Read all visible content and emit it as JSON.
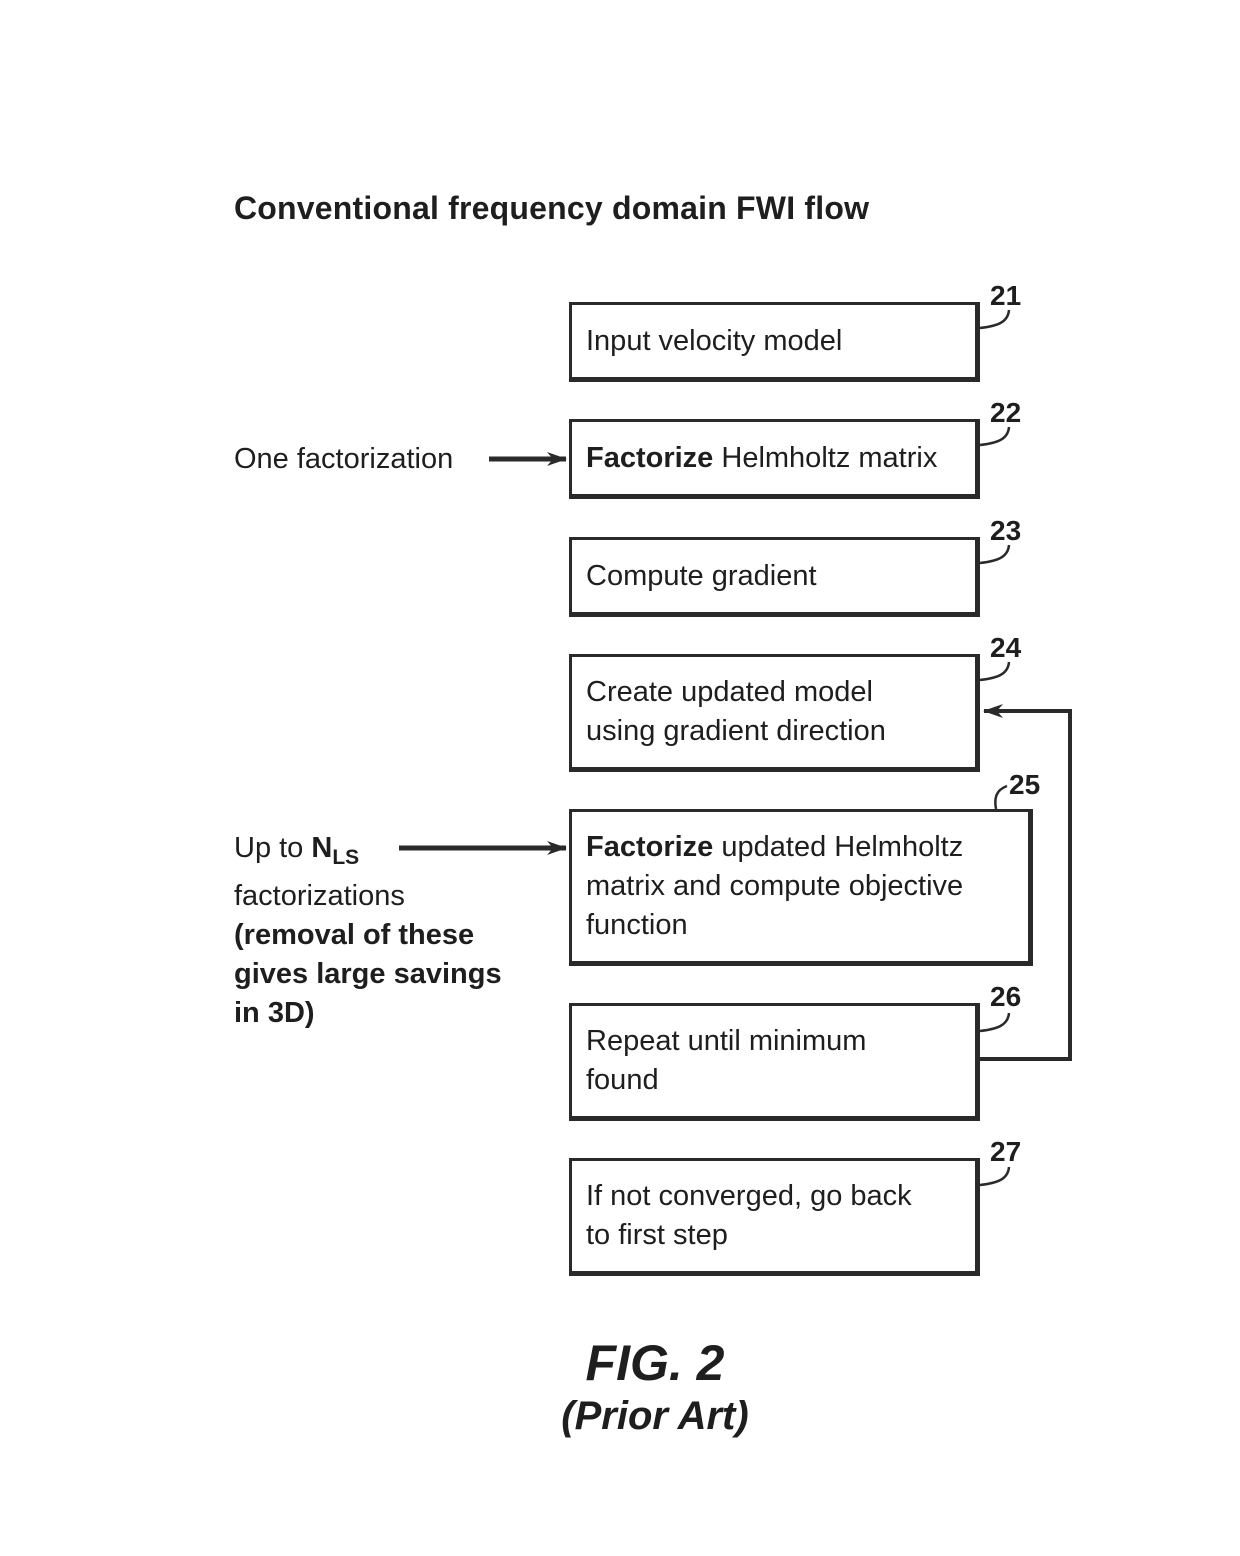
{
  "title": "Conventional frequency domain FWI flow",
  "steps": [
    {
      "ref": "21",
      "bold": "",
      "text": "Input velocity model",
      "text2": ""
    },
    {
      "ref": "22",
      "bold": "Factorize",
      "text": " Helmholtz matrix",
      "text2": ""
    },
    {
      "ref": "23",
      "bold": "",
      "text": "Compute gradient",
      "text2": ""
    },
    {
      "ref": "24",
      "bold": "",
      "text": "Create updated model",
      "text2": "using gradient direction"
    },
    {
      "ref": "25",
      "bold": "Factorize",
      "text": " updated Helmholtz",
      "text2": "matrix and compute objective",
      "text3": "function"
    },
    {
      "ref": "26",
      "bold": "",
      "text": "Repeat until minimum",
      "text2": "found"
    },
    {
      "ref": "27",
      "bold": "",
      "text": "If not converged, go back",
      "text2": "to first step"
    }
  ],
  "annotations": {
    "one_factorization": "One factorization",
    "up_to": "Up to ",
    "n_symbol": "N",
    "n_subscript": "LS",
    "factorizations": "factorizations",
    "removal_line1": "(removal of these",
    "removal_line2": "gives large savings",
    "removal_line3": "in 3D)"
  },
  "figure": {
    "label": "FIG. 2",
    "sublabel": "(Prior Art)"
  }
}
